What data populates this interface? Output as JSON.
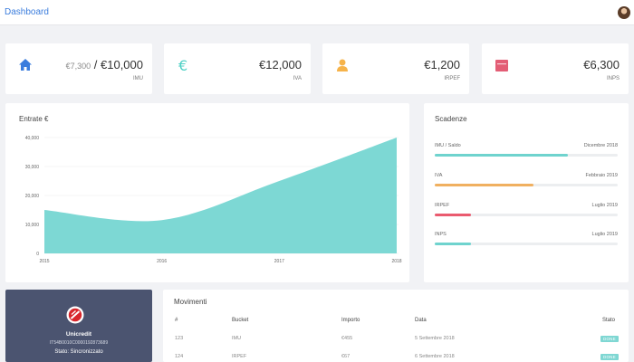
{
  "header": {
    "title": "Dashboard"
  },
  "stats": [
    {
      "name": "IMU",
      "icon": "home-icon",
      "muted": "€7,300",
      "separator": " / ",
      "value": "€10,000",
      "label": "IMU",
      "color": "#3b7ddd"
    },
    {
      "name": "IVA",
      "icon": "euro-icon",
      "value": "€12,000",
      "label": "IVA",
      "color": "#4fd1c5"
    },
    {
      "name": "IRPEF",
      "icon": "user-icon",
      "value": "€1,200",
      "label": "IRPEF",
      "color": "#f6b34a"
    },
    {
      "name": "INPS",
      "icon": "calendar-icon",
      "value": "€6,300",
      "label": "INPS",
      "color": "#e35d75"
    }
  ],
  "chart_data": {
    "type": "area",
    "title": "Entrate €",
    "x": [
      "2015",
      "2016",
      "2017",
      "2018"
    ],
    "series": [
      {
        "values": [
          15000,
          11500,
          25000,
          40000
        ]
      }
    ],
    "yticks": [
      "40,000",
      "30,000",
      "20,000",
      "10,000",
      "0"
    ],
    "ylim": [
      0,
      40000
    ],
    "color": "#7dd8d4",
    "grid": true
  },
  "scadenze": {
    "title": "Scadenze",
    "items": [
      {
        "name": "IMU / Saldo",
        "date": "Dicembre 2018",
        "progress": 0.73,
        "color": "#6fd3ce"
      },
      {
        "name": "IVA",
        "date": "Febbraio 2019",
        "progress": 0.54,
        "color": "#f0b060"
      },
      {
        "name": "IRPEF",
        "date": "Luglio 2019",
        "progress": 0.2,
        "color": "#ea5b6f"
      },
      {
        "name": "INPS",
        "date": "Luglio 2019",
        "progress": 0.2,
        "color": "#6fd3ce"
      }
    ]
  },
  "bank": {
    "name": "Unicredit",
    "iban": "IT54B0010C000019287368​9",
    "status": "Stato: Sincronizzato"
  },
  "movimenti": {
    "title": "Movimenti",
    "headers": [
      "#",
      "Bucket",
      "Importo",
      "Data",
      "Stato"
    ],
    "rows": [
      {
        "id": "123",
        "bucket": "IMU",
        "importo": "€455",
        "data": "5 Settembre 2018",
        "stato": "DONE"
      },
      {
        "id": "124",
        "bucket": "IRPEF",
        "importo": "€67",
        "data": "6 Settembre 2018",
        "stato": "DONE"
      }
    ]
  }
}
